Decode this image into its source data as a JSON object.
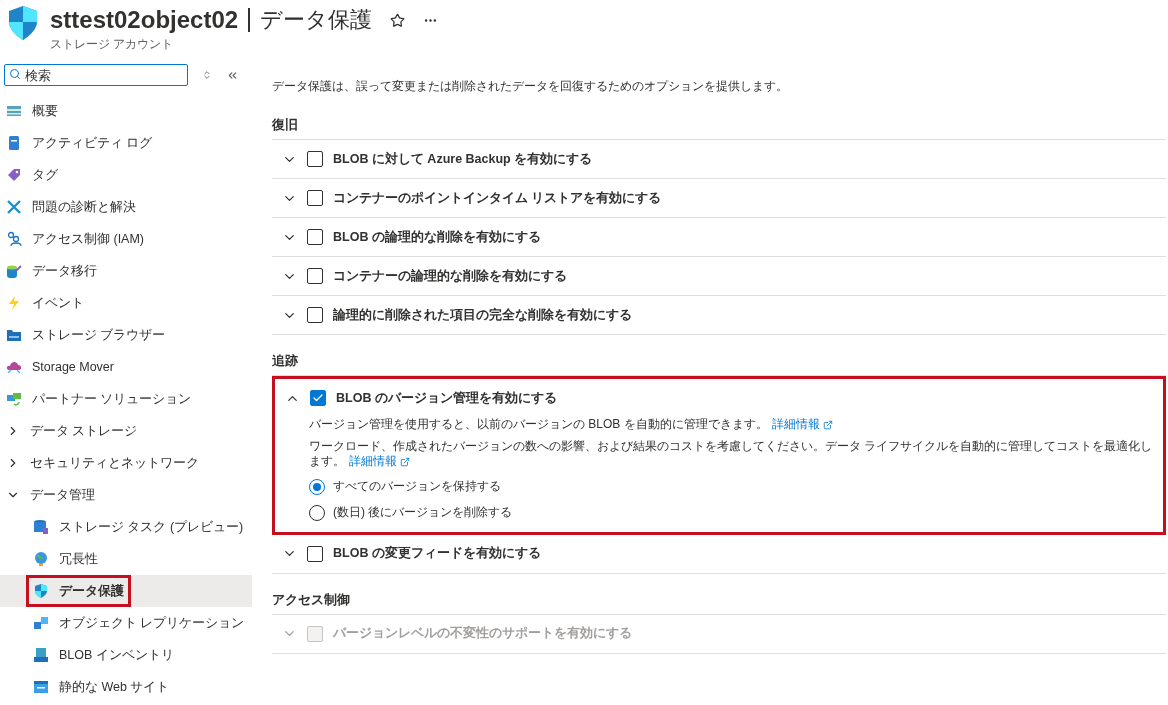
{
  "header": {
    "title": "sttest02object02",
    "page": "データ保護",
    "subtitle": "ストレージ アカウント"
  },
  "sidebar": {
    "search": {
      "placeholder": "検索"
    },
    "items": [
      {
        "label": "概要",
        "selected": false
      },
      {
        "label": "アクティビティ ログ",
        "selected": false
      },
      {
        "label": "タグ",
        "selected": false
      },
      {
        "label": "問題の診断と解決",
        "selected": false
      },
      {
        "label": "アクセス制御 (IAM)",
        "selected": false
      },
      {
        "label": "データ移行",
        "selected": false
      },
      {
        "label": "イベント",
        "selected": false
      },
      {
        "label": "ストレージ ブラウザー",
        "selected": false
      },
      {
        "label": "Storage Mover",
        "selected": false
      },
      {
        "label": "パートナー ソリューション",
        "selected": false
      },
      {
        "label": "データ ストレージ",
        "selected": false,
        "expanded": false
      },
      {
        "label": "セキュリティとネットワーク",
        "selected": false,
        "expanded": false
      },
      {
        "label": "データ管理",
        "selected": false,
        "expanded": true,
        "children": [
          {
            "label": "ストレージ タスク (プレビュー)",
            "selected": false,
            "highlighted": false
          },
          {
            "label": "冗長性",
            "selected": false,
            "highlighted": false
          },
          {
            "label": "データ保護",
            "selected": true,
            "highlighted": true
          },
          {
            "label": "オブジェクト レプリケーション",
            "selected": false,
            "highlighted": false
          },
          {
            "label": "BLOB インベントリ",
            "selected": false,
            "highlighted": false
          },
          {
            "label": "静的な Web サイト",
            "selected": false,
            "highlighted": false
          }
        ]
      }
    ]
  },
  "main": {
    "description": "データ保護は、誤って変更または削除されたデータを回復するためのオプションを提供します。",
    "sections": [
      {
        "title": "復旧",
        "options": [
          {
            "label": "BLOB に対して Azure Backup を有効にする",
            "checked": false,
            "expanded": false,
            "disabled": false,
            "highlighted": false
          },
          {
            "label": "コンテナーのポイントインタイム リストアを有効にする",
            "checked": false,
            "expanded": false,
            "disabled": false,
            "highlighted": false
          },
          {
            "label": "BLOB の論理的な削除を有効にする",
            "checked": false,
            "expanded": false,
            "disabled": false,
            "highlighted": false
          },
          {
            "label": "コンテナーの論理的な削除を有効にする",
            "checked": false,
            "expanded": false,
            "disabled": false,
            "highlighted": false
          },
          {
            "label": "論理的に削除された項目の完全な削除を有効にする",
            "checked": false,
            "expanded": false,
            "disabled": false,
            "highlighted": false
          }
        ]
      },
      {
        "title": "追跡",
        "options": [
          {
            "label": "BLOB のバージョン管理を有効にする",
            "checked": true,
            "expanded": true,
            "disabled": false,
            "highlighted": true,
            "paragraphs": [
              {
                "text": "バージョン管理を使用すると、以前のバージョンの BLOB を自動的に管理できます。",
                "link": "詳細情報"
              },
              {
                "text": "ワークロード、作成されたバージョンの数への影響、および結果のコストを考慮してください。データ ライフサイクルを自動的に管理してコストを最適化します。",
                "link": "詳細情報"
              }
            ],
            "radios": [
              {
                "label": "すべてのバージョンを保持する",
                "selected": true
              },
              {
                "label": "(数日) 後にバージョンを削除する",
                "selected": false
              }
            ]
          },
          {
            "label": "BLOB の変更フィードを有効にする",
            "checked": false,
            "expanded": false,
            "disabled": false,
            "highlighted": false
          }
        ]
      },
      {
        "title": "アクセス制御",
        "options": [
          {
            "label": "バージョンレベルの不変性のサポートを有効にする",
            "checked": false,
            "expanded": false,
            "disabled": true,
            "highlighted": false
          }
        ]
      }
    ]
  }
}
